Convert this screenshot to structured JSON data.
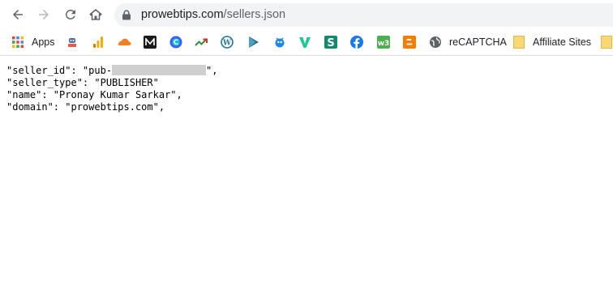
{
  "browser": {
    "url_host": "prowebtips.com",
    "url_path": "/sellers.json"
  },
  "bookmarks": {
    "apps_label": "Apps",
    "recaptcha_label": "reCAPTCHA",
    "affiliate_label": "Affiliate Sites"
  },
  "json_lines": {
    "line1_prefix": "\"seller_id\": \"pub-",
    "line1_suffix": "\",",
    "line2": "\"seller_type\": \"PUBLISHER\"",
    "line3": "\"name\": \"Pronay Kumar Sarkar\",",
    "line4": "\"domain\": \"prowebtips.com\","
  }
}
